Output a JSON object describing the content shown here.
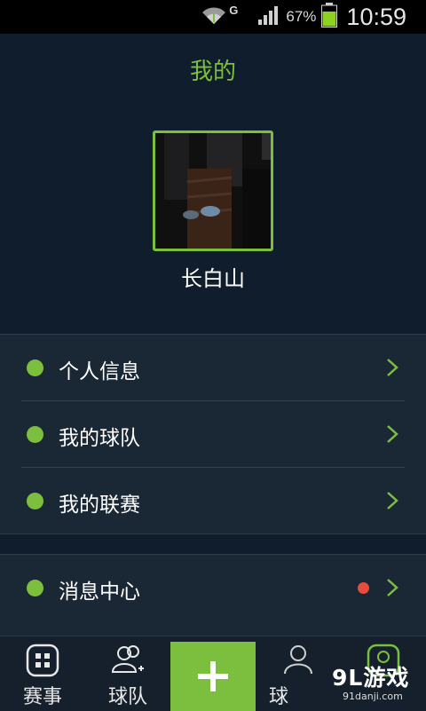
{
  "status_bar": {
    "network_letter": "G",
    "battery_text": "67%",
    "time": "10:59"
  },
  "header": {
    "title": "我的"
  },
  "profile": {
    "username": "长白山"
  },
  "menu": {
    "group1": [
      {
        "label": "个人信息",
        "icon": "dot-indicator"
      },
      {
        "label": "我的球队",
        "icon": "dot-indicator"
      },
      {
        "label": "我的联赛",
        "icon": "dot-indicator"
      }
    ],
    "group2": [
      {
        "label": "消息中心",
        "icon": "dot-indicator",
        "has_new_badge": true
      }
    ]
  },
  "tabbar": {
    "tabs": [
      {
        "label": "赛事",
        "icon": "grid-icon"
      },
      {
        "label": "球队",
        "icon": "team-add-icon"
      },
      {
        "label": "",
        "icon": "plus-icon"
      },
      {
        "label": "球",
        "icon": "person-icon"
      },
      {
        "label": "",
        "icon": "profile-icon"
      }
    ]
  },
  "watermark": {
    "main": "9L游戏",
    "sub": "91danji.com"
  },
  "colors": {
    "accent": "#7cbf3f",
    "background": "#0f1d2c",
    "panel": "#1a2735",
    "badge": "#e74c3c"
  }
}
